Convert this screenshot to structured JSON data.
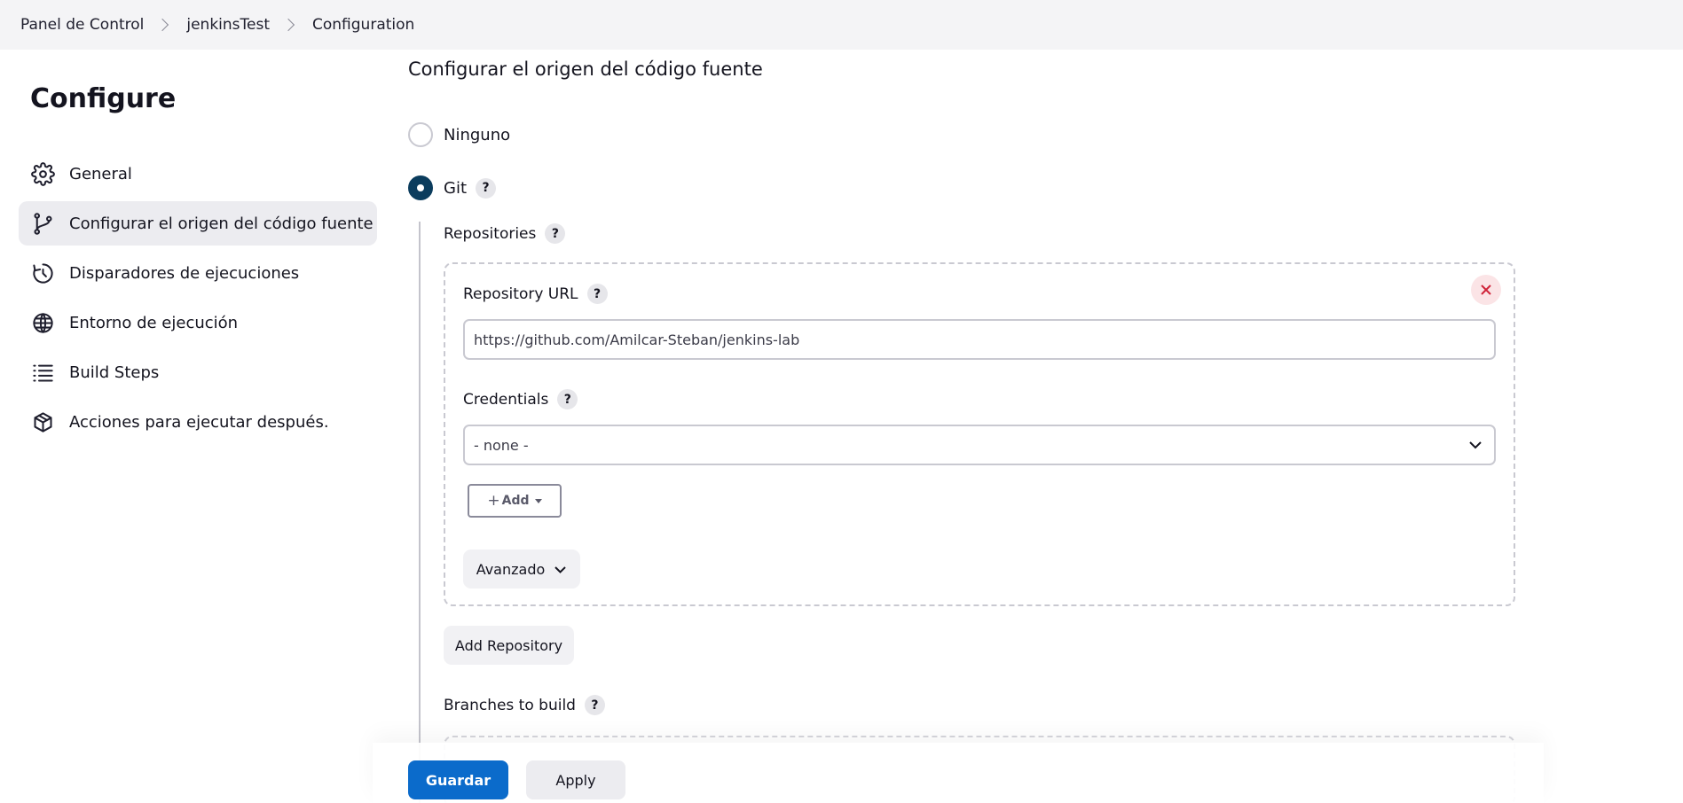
{
  "breadcrumb": {
    "items": [
      "Panel de Control",
      "jenkinsTest",
      "Configuration"
    ]
  },
  "sidebar": {
    "title": "Configure",
    "items": [
      {
        "label": "General",
        "icon": "gear-icon",
        "active": false
      },
      {
        "label": "Configurar el origen del código fuente",
        "icon": "git-branch-icon",
        "active": true
      },
      {
        "label": "Disparadores de ejecuciones",
        "icon": "clock-icon",
        "active": false
      },
      {
        "label": "Entorno de ejecución",
        "icon": "globe-icon",
        "active": false
      },
      {
        "label": "Build Steps",
        "icon": "list-icon",
        "active": false
      },
      {
        "label": "Acciones para ejecutar después.",
        "icon": "package-icon",
        "active": false
      }
    ]
  },
  "main": {
    "section_title": "Configurar el origen del código fuente",
    "scm_options": [
      {
        "label": "Ninguno",
        "checked": false
      },
      {
        "label": "Git",
        "checked": true
      }
    ],
    "help_glyph": "?",
    "repositories_label": "Repositories",
    "repository": {
      "url_label": "Repository URL",
      "url_value": "https://github.com/Amilcar-Steban/jenkins-lab",
      "credentials_label": "Credentials",
      "credentials_value": "- none -",
      "add_label": "Add",
      "advanced_label": "Avanzado"
    },
    "add_repository_label": "Add Repository",
    "branches_label": "Branches to build"
  },
  "footer": {
    "save_label": "Guardar",
    "apply_label": "Apply"
  },
  "colors": {
    "primary": "#0b6bcb",
    "radio_checked": "#0b3c5d",
    "danger": "#d0243a",
    "topbar_bg": "#f4f4f6"
  }
}
